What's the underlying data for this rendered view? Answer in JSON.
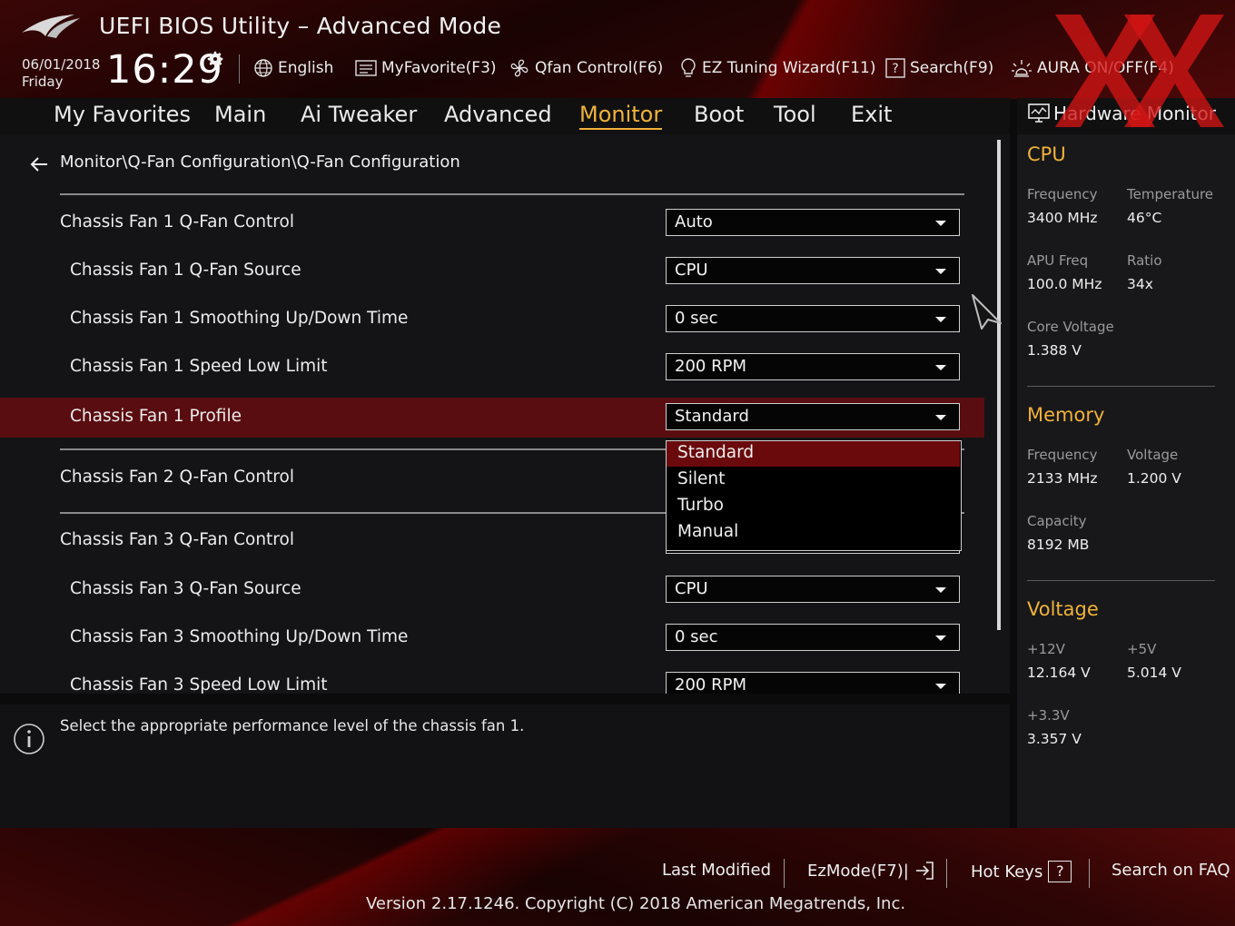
{
  "header": {
    "title": "UEFI BIOS Utility – Advanced Mode",
    "date": "06/01/2018",
    "day": "Friday",
    "time": "16:29",
    "nav": [
      {
        "label": "English",
        "icon": "globe-icon"
      },
      {
        "label": "MyFavorite(F3)",
        "icon": "favorites-icon"
      },
      {
        "label": "Qfan Control(F6)",
        "icon": "fan-icon"
      },
      {
        "label": "EZ Tuning Wizard(F11)",
        "icon": "lightbulb-icon"
      },
      {
        "label": "Search(F9)",
        "icon": "help-box-icon"
      },
      {
        "label": "AURA ON/OFF(F4)",
        "icon": "aura-icon"
      }
    ]
  },
  "tabs": [
    {
      "label": "My Favorites"
    },
    {
      "label": "Main"
    },
    {
      "label": "Ai Tweaker"
    },
    {
      "label": "Advanced"
    },
    {
      "label": "Monitor",
      "active": true
    },
    {
      "label": "Boot"
    },
    {
      "label": "Tool"
    },
    {
      "label": "Exit"
    }
  ],
  "breadcrumb": "Monitor\\Q-Fan Configuration\\Q-Fan Configuration",
  "settings": [
    {
      "label": "Chassis Fan 1 Q-Fan Control",
      "value": "Auto"
    },
    {
      "label": "Chassis Fan 1 Q-Fan Source",
      "value": "CPU"
    },
    {
      "label": "Chassis Fan 1 Smoothing Up/Down Time",
      "value": "0 sec"
    },
    {
      "label": "Chassis Fan 1 Speed Low Limit",
      "value": "200 RPM"
    },
    {
      "label": "Chassis Fan 1 Profile",
      "value": "Standard"
    },
    {
      "label": "Chassis Fan 2 Q-Fan Control",
      "value": ""
    },
    {
      "label": "Chassis Fan 3 Q-Fan Control",
      "value": ""
    },
    {
      "label": "Chassis Fan 3 Q-Fan Source",
      "value": "CPU"
    },
    {
      "label": "Chassis Fan 3 Smoothing Up/Down Time",
      "value": "0 sec"
    },
    {
      "label": "Chassis Fan 3 Speed Low Limit",
      "value": "200 RPM"
    }
  ],
  "profile_options": [
    "Standard",
    "Silent",
    "Turbo",
    "Manual"
  ],
  "info_text": "Select the appropriate performance level of the chassis fan 1.",
  "hw_monitor": {
    "title": "Hardware Monitor",
    "cpu": {
      "heading": "CPU",
      "freq_label": "Frequency",
      "freq": "3400 MHz",
      "temp_label": "Temperature",
      "temp": "46°C",
      "apu_label": "APU Freq",
      "apu": "100.0 MHz",
      "ratio_label": "Ratio",
      "ratio": "34x",
      "vcore_label": "Core Voltage",
      "vcore": "1.388 V"
    },
    "memory": {
      "heading": "Memory",
      "freq_label": "Frequency",
      "freq": "2133 MHz",
      "volt_label": "Voltage",
      "volt": "1.200 V",
      "cap_label": "Capacity",
      "cap": "8192 MB"
    },
    "voltage": {
      "heading": "Voltage",
      "v12_label": "+12V",
      "v12": "12.164 V",
      "v5_label": "+5V",
      "v5": "5.014 V",
      "v33_label": "+3.3V",
      "v33": "3.357 V"
    }
  },
  "footer": {
    "last_modified": "Last Modified",
    "ezmode": "EzMode(F7)|",
    "hot_keys": "Hot Keys",
    "hot_keys_key": "?",
    "faq": "Search on FAQ",
    "version": "Version 2.17.1246. Copyright (C) 2018 American Megatrends, Inc."
  },
  "colors": {
    "accent": "#f0b23a",
    "selected_row": "#5a0d10",
    "dropdown_highlight": "#6a0a0c",
    "header_red": "#3a0606"
  }
}
